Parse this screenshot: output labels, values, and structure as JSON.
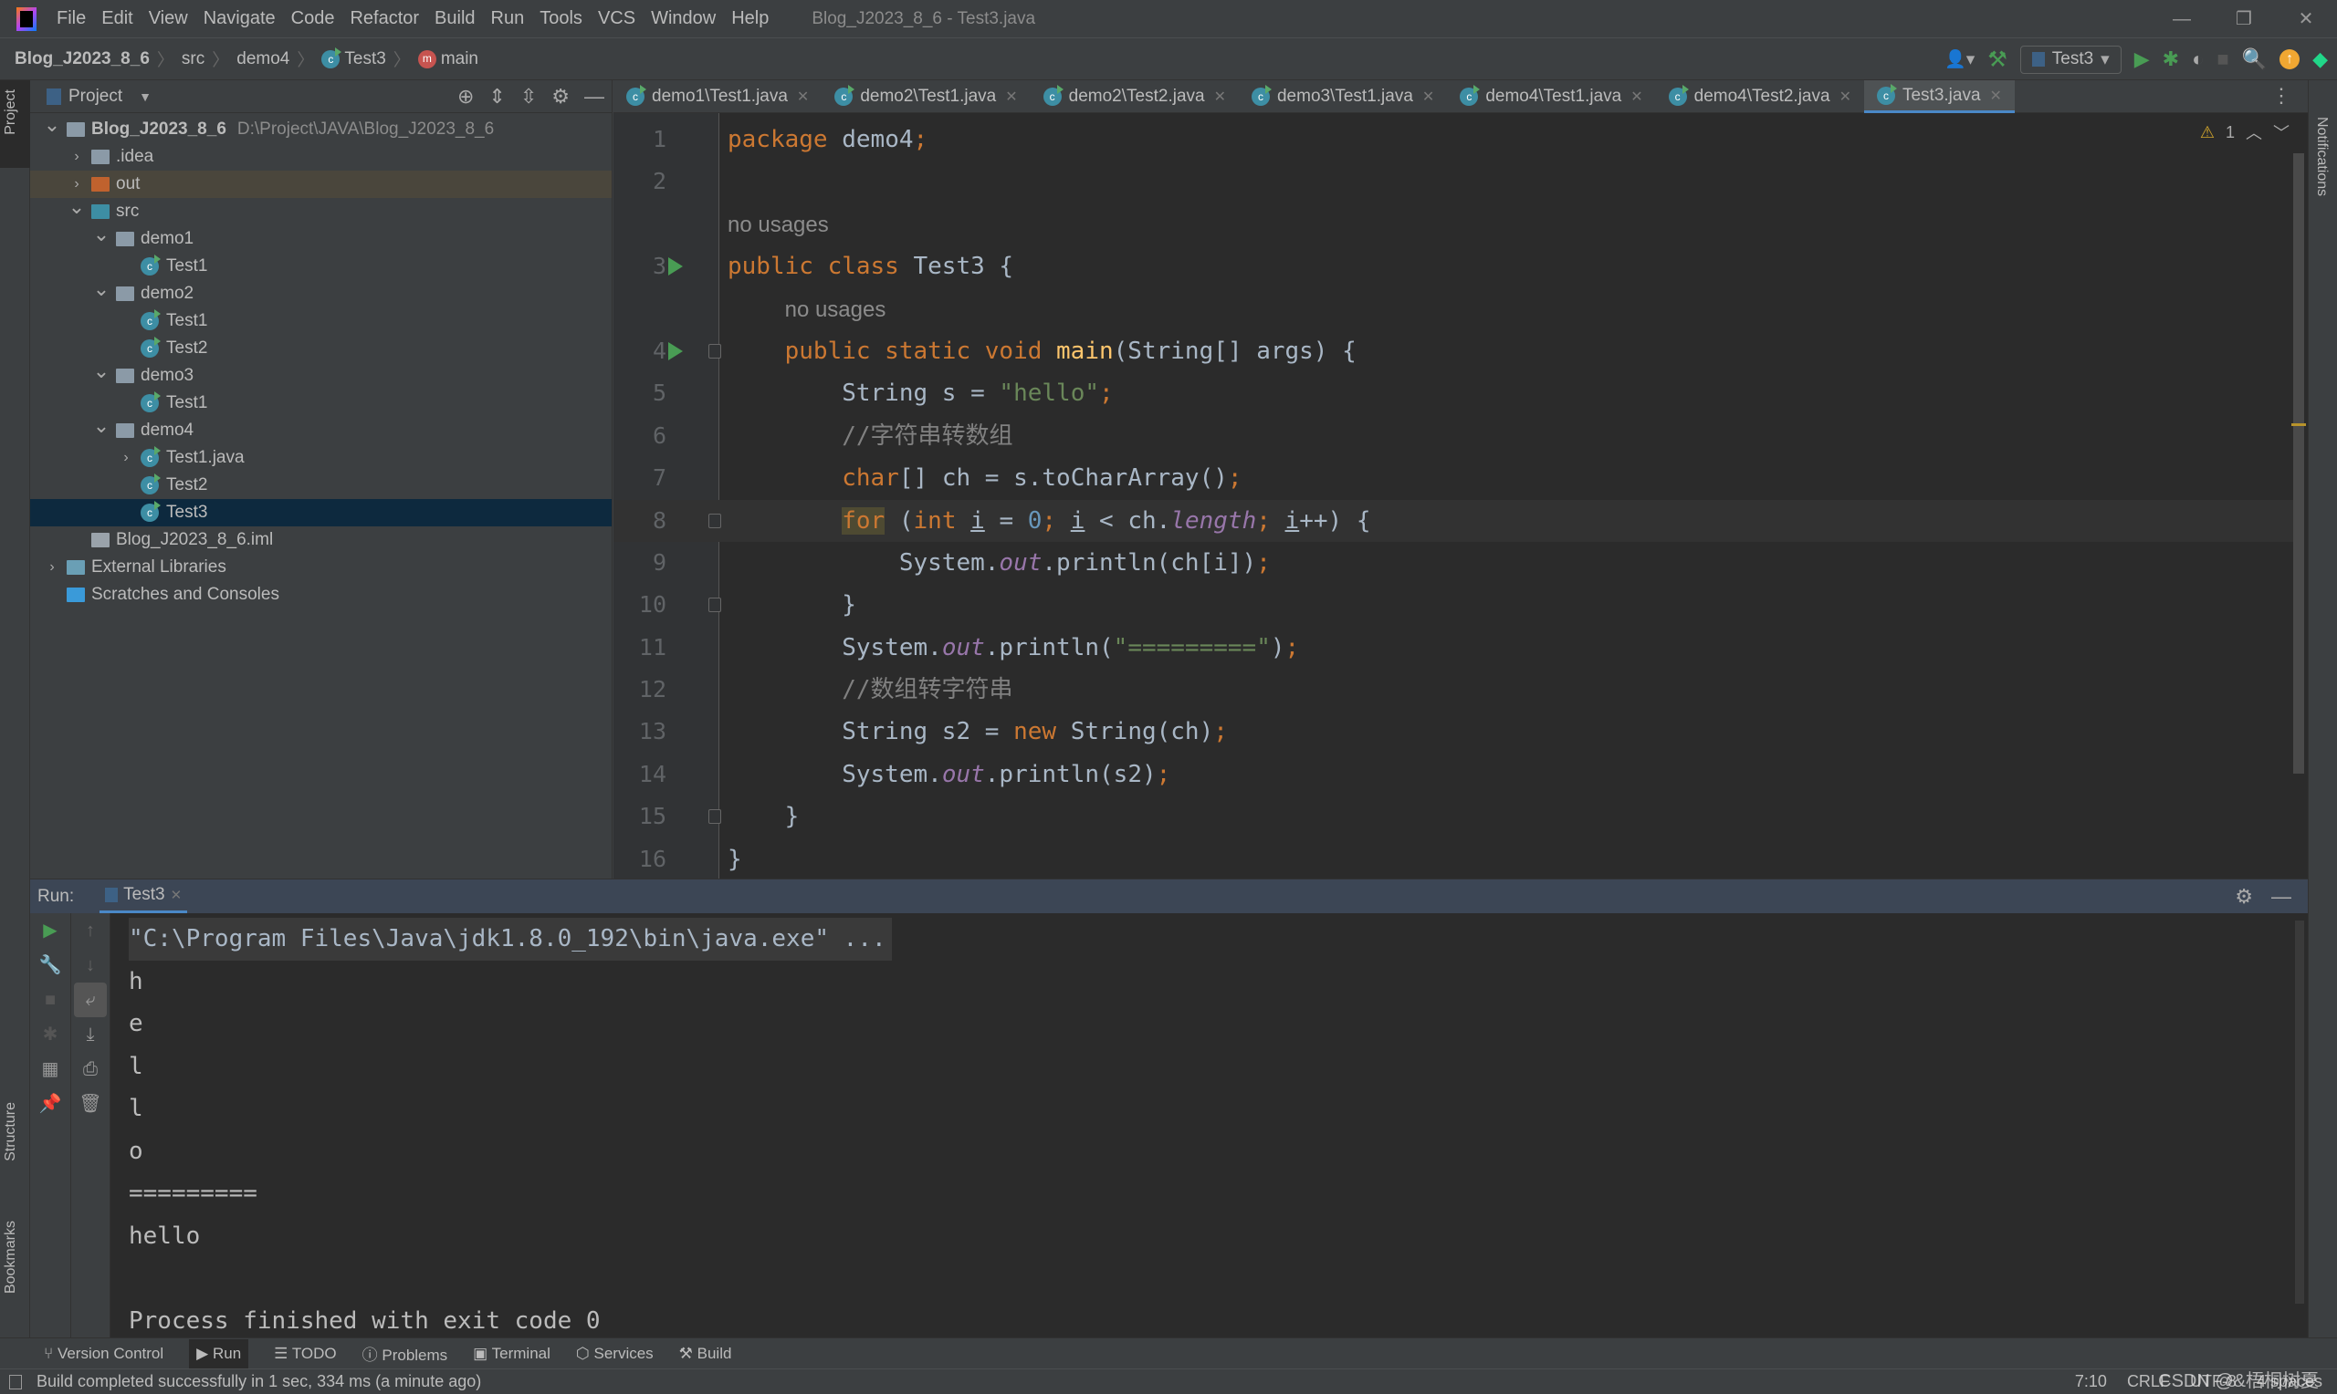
{
  "titlebar": {
    "menu": [
      "File",
      "Edit",
      "View",
      "Navigate",
      "Code",
      "Refactor",
      "Build",
      "Run",
      "Tools",
      "VCS",
      "Window",
      "Help"
    ],
    "title": "Blog_J2023_8_6 - Test3.java"
  },
  "navbar": {
    "breadcrumb": [
      "Blog_J2023_8_6",
      "src",
      "demo4",
      "Test3",
      "main"
    ],
    "run_config": "Test3"
  },
  "left_stripe": {
    "project": "Project",
    "structure": "Structure",
    "bookmarks": "Bookmarks"
  },
  "right_stripe": {
    "notifications": "Notifications"
  },
  "project": {
    "title": "Project",
    "tree": [
      {
        "label": "Blog_J2023_8_6",
        "path": "D:\\Project\\JAVA\\Blog_J2023_8_6",
        "depth": 0,
        "arrow": "down",
        "icon": "module"
      },
      {
        "label": ".idea",
        "depth": 1,
        "arrow": "right",
        "icon": "folder"
      },
      {
        "label": "out",
        "depth": 1,
        "arrow": "right",
        "icon": "folder-excluded"
      },
      {
        "label": "src",
        "depth": 1,
        "arrow": "down",
        "icon": "folder-source"
      },
      {
        "label": "demo1",
        "depth": 2,
        "arrow": "down",
        "icon": "package"
      },
      {
        "label": "Test1",
        "depth": 3,
        "icon": "class"
      },
      {
        "label": "demo2",
        "depth": 2,
        "arrow": "down",
        "icon": "package"
      },
      {
        "label": "Test1",
        "depth": 3,
        "icon": "class"
      },
      {
        "label": "Test2",
        "depth": 3,
        "icon": "class"
      },
      {
        "label": "demo3",
        "depth": 2,
        "arrow": "down",
        "icon": "package"
      },
      {
        "label": "Test1",
        "depth": 3,
        "icon": "class"
      },
      {
        "label": "demo4",
        "depth": 2,
        "arrow": "down",
        "icon": "package"
      },
      {
        "label": "Test1.java",
        "depth": 3,
        "arrow": "right",
        "icon": "class"
      },
      {
        "label": "Test2",
        "depth": 3,
        "icon": "class"
      },
      {
        "label": "Test3",
        "depth": 3,
        "icon": "class",
        "selected": true
      },
      {
        "label": "Blog_J2023_8_6.iml",
        "depth": 1,
        "icon": "iml-file"
      },
      {
        "label": "External Libraries",
        "depth": 0,
        "arrow": "right",
        "icon": "libraries"
      },
      {
        "label": "Scratches and Consoles",
        "depth": 0,
        "icon": "scratches"
      }
    ]
  },
  "editor": {
    "tabs": [
      "demo1\\Test1.java",
      "demo2\\Test1.java",
      "demo2\\Test2.java",
      "demo3\\Test1.java",
      "demo4\\Test1.java",
      "demo4\\Test2.java",
      "Test3.java"
    ],
    "active_tab": "Test3.java",
    "warnings": "1",
    "lines": [
      {
        "n": "1",
        "tokens": [
          [
            "package ",
            "kw"
          ],
          [
            "demo4",
            "pl"
          ],
          [
            ";",
            "kw"
          ]
        ]
      },
      {
        "n": "2",
        "tokens": []
      },
      {
        "n": "",
        "hint": "no usages",
        "indent": 0
      },
      {
        "n": "3",
        "run": true,
        "tokens": [
          [
            "public class ",
            "kw"
          ],
          [
            "Test3 {",
            "pl"
          ]
        ]
      },
      {
        "n": "",
        "hint": "no usages",
        "indent": 4
      },
      {
        "n": "4",
        "run": true,
        "fold": true,
        "tokens": [
          [
            "    public static void ",
            "kw"
          ],
          [
            "main",
            "fn"
          ],
          [
            "(String[] args) {",
            "pl"
          ]
        ]
      },
      {
        "n": "5",
        "tokens": [
          [
            "        String s = ",
            "pl"
          ],
          [
            "\"hello\"",
            "str"
          ],
          [
            ";",
            "kw"
          ]
        ]
      },
      {
        "n": "6",
        "tokens": [
          [
            "        //字符串转数组",
            "cm"
          ]
        ]
      },
      {
        "n": "7",
        "tokens": [
          [
            "        ",
            "pl"
          ],
          [
            "char",
            "kw"
          ],
          [
            "[] ch = s.toCharArray()",
            "pl"
          ],
          [
            ";",
            "kw"
          ]
        ]
      },
      {
        "n": "8",
        "current": true,
        "fold": true,
        "tokens": [
          [
            "        ",
            "pl"
          ],
          [
            "for",
            "kw hl"
          ],
          [
            " (",
            "pl"
          ],
          [
            "int ",
            "kw"
          ],
          [
            "i",
            "pl under"
          ],
          [
            " = ",
            "pl"
          ],
          [
            "0",
            "num"
          ],
          [
            "; ",
            "kw"
          ],
          [
            "i",
            "pl under"
          ],
          [
            " < ch.",
            "pl"
          ],
          [
            "length",
            "fld"
          ],
          [
            "; ",
            "kw"
          ],
          [
            "i",
            "pl under"
          ],
          [
            "++) {",
            "pl"
          ]
        ]
      },
      {
        "n": "9",
        "tokens": [
          [
            "            System.",
            "pl"
          ],
          [
            "out",
            "fld"
          ],
          [
            ".println(ch[i])",
            "pl"
          ],
          [
            ";",
            "kw"
          ]
        ]
      },
      {
        "n": "10",
        "fold": true,
        "tokens": [
          [
            "        }",
            "pl"
          ]
        ]
      },
      {
        "n": "11",
        "tokens": [
          [
            "        System.",
            "pl"
          ],
          [
            "out",
            "fld"
          ],
          [
            ".println(",
            "pl"
          ],
          [
            "\"=========\"",
            "str"
          ],
          [
            ")",
            "pl"
          ],
          [
            ";",
            "kw"
          ]
        ]
      },
      {
        "n": "12",
        "tokens": [
          [
            "        //数组转字符串",
            "cm"
          ]
        ]
      },
      {
        "n": "13",
        "tokens": [
          [
            "        String s2 = ",
            "pl"
          ],
          [
            "new ",
            "kw"
          ],
          [
            "String(ch)",
            "pl"
          ],
          [
            ";",
            "kw"
          ]
        ]
      },
      {
        "n": "14",
        "tokens": [
          [
            "        System.",
            "pl"
          ],
          [
            "out",
            "fld"
          ],
          [
            ".println(s2)",
            "pl"
          ],
          [
            ";",
            "kw"
          ]
        ]
      },
      {
        "n": "15",
        "fold": true,
        "tokens": [
          [
            "    }",
            "pl"
          ]
        ]
      },
      {
        "n": "16",
        "tokens": [
          [
            "}",
            "pl"
          ]
        ]
      }
    ]
  },
  "run": {
    "label": "Run:",
    "tab": "Test3",
    "output": [
      "\"C:\\Program Files\\Java\\jdk1.8.0_192\\bin\\java.exe\" ...",
      "h",
      "e",
      "l",
      "l",
      "o",
      "=========",
      "hello",
      "",
      "Process finished with exit code 0"
    ]
  },
  "bottom_tabs": [
    "Version Control",
    "Run",
    "TODO",
    "Problems",
    "Terminal",
    "Services",
    "Build"
  ],
  "status": {
    "message": "Build completed successfully in 1 sec, 334 ms (a minute ago)",
    "position": "7:10",
    "line_sep": "CRLF",
    "encoding": "UTF-8",
    "indent": "4 spaces",
    "watermark": "CSDN @&梧桐树夏"
  },
  "colors": {
    "keyword": "#cc7832",
    "string": "#6a8759",
    "comment": "#808080",
    "field": "#9876aa",
    "method": "#ffc66d",
    "number": "#6897bb",
    "text": "#a9b7c6",
    "accent": "#4a88c7",
    "run_green": "#499c54"
  }
}
